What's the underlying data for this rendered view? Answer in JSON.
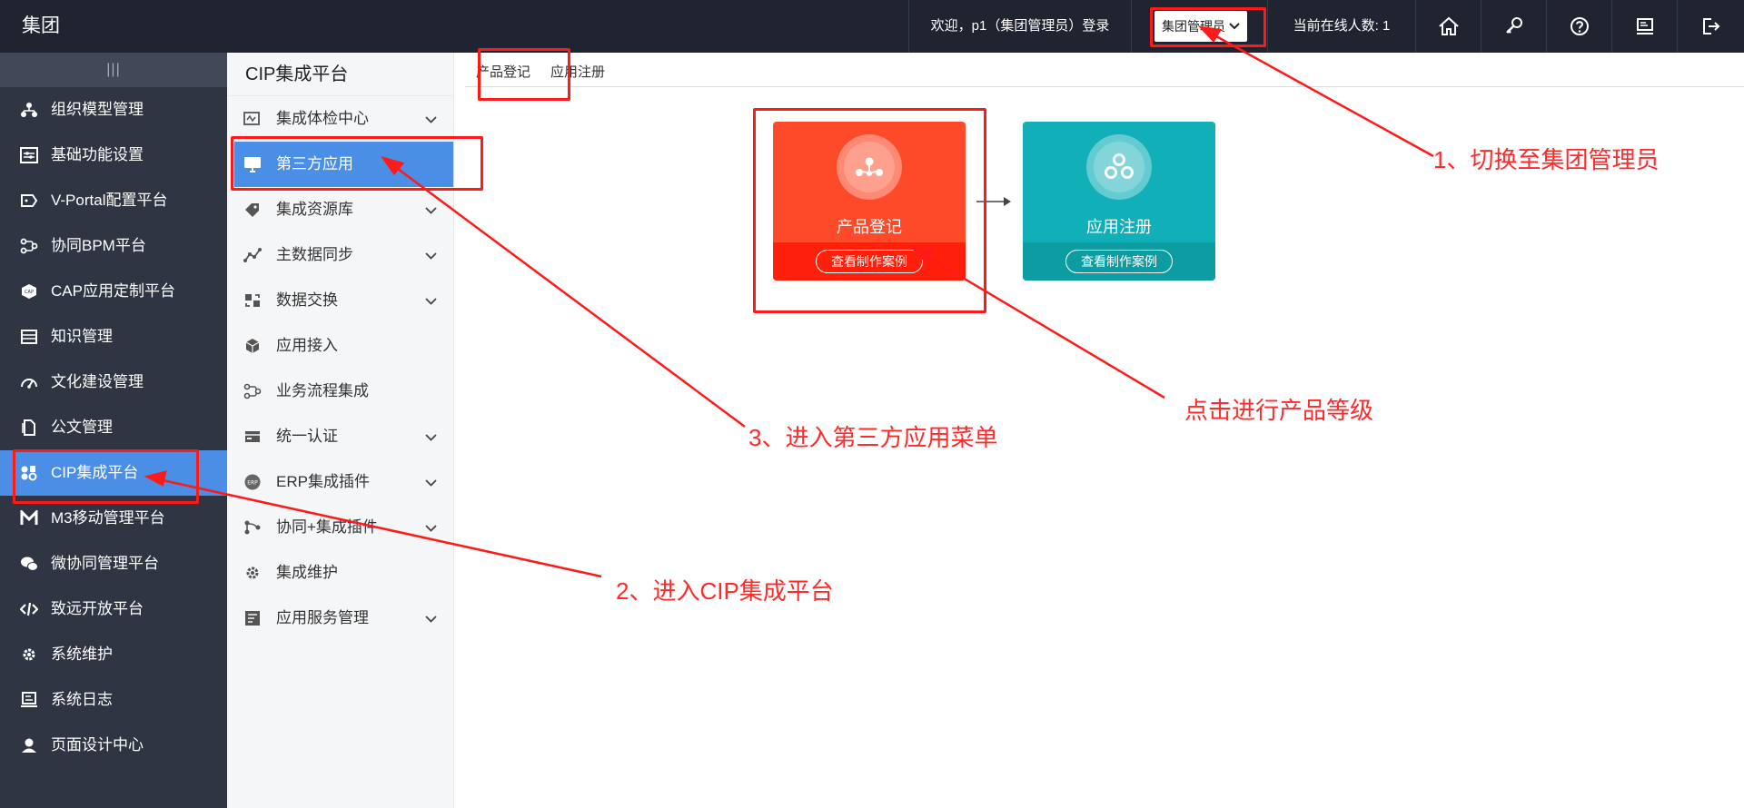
{
  "header": {
    "brand": "集团",
    "welcome": "欢迎，p1（集团管理员）登录",
    "role_select": "集团管理员",
    "online": "当前在线人数: 1",
    "icons": [
      "home-icon",
      "key-icon",
      "help-icon",
      "monitor-icon",
      "logout-icon"
    ]
  },
  "leftnav": {
    "collapse_glyph": "|||",
    "items": [
      {
        "label": "组织模型管理",
        "icon": "org-tree-icon"
      },
      {
        "label": "基础功能设置",
        "icon": "settings-panel-icon"
      },
      {
        "label": "V-Portal配置平台",
        "icon": "portal-icon"
      },
      {
        "label": "协同BPM平台",
        "icon": "bpm-icon"
      },
      {
        "label": "CAP应用定制平台",
        "icon": "cap-icon"
      },
      {
        "label": "知识管理",
        "icon": "knowledge-icon"
      },
      {
        "label": "文化建设管理",
        "icon": "culture-icon"
      },
      {
        "label": "公文管理",
        "icon": "document-icon"
      },
      {
        "label": "CIP集成平台",
        "icon": "cip-icon",
        "active": true
      },
      {
        "label": "M3移动管理平台",
        "icon": "m3-icon"
      },
      {
        "label": "微协同管理平台",
        "icon": "wechat-icon"
      },
      {
        "label": "致远开放平台",
        "icon": "code-icon"
      },
      {
        "label": "系统维护",
        "icon": "gear-icon"
      },
      {
        "label": "系统日志",
        "icon": "log-icon"
      },
      {
        "label": "页面设计中心",
        "icon": "user-design-icon"
      }
    ]
  },
  "subnav": {
    "title": "CIP集成平台",
    "items": [
      {
        "label": "集成体检中心",
        "expandable": true
      },
      {
        "label": "第三方应用",
        "expandable": false,
        "active": true
      },
      {
        "label": "集成资源库",
        "expandable": true
      },
      {
        "label": "主数据同步",
        "expandable": true
      },
      {
        "label": "数据交换",
        "expandable": true
      },
      {
        "label": "应用接入",
        "expandable": false
      },
      {
        "label": "业务流程集成",
        "expandable": false
      },
      {
        "label": "统一认证",
        "expandable": true
      },
      {
        "label": "ERP集成插件",
        "expandable": true
      },
      {
        "label": "协同+集成插件",
        "expandable": true
      },
      {
        "label": "集成维护",
        "expandable": false
      },
      {
        "label": "应用服务管理",
        "expandable": true
      }
    ]
  },
  "main": {
    "tabs": [
      "产品登记",
      "应用注册"
    ],
    "cards": [
      {
        "label": "产品登记",
        "button": "查看制作案例",
        "color": "#ff4a2a"
      },
      {
        "label": "应用注册",
        "button": "查看制作案例",
        "color": "#11b0b8"
      }
    ]
  },
  "annotations": {
    "step1": "1、切换至集团管理员",
    "step2": "2、进入CIP集成平台",
    "step3": "3、进入第三方应用菜单",
    "step4": "点击进行产品等级"
  },
  "colors": {
    "accent": "#4a8ee6",
    "annotation": "#ff1a1a",
    "topbar": "#1f2430",
    "sidebar": "#2f3542"
  }
}
